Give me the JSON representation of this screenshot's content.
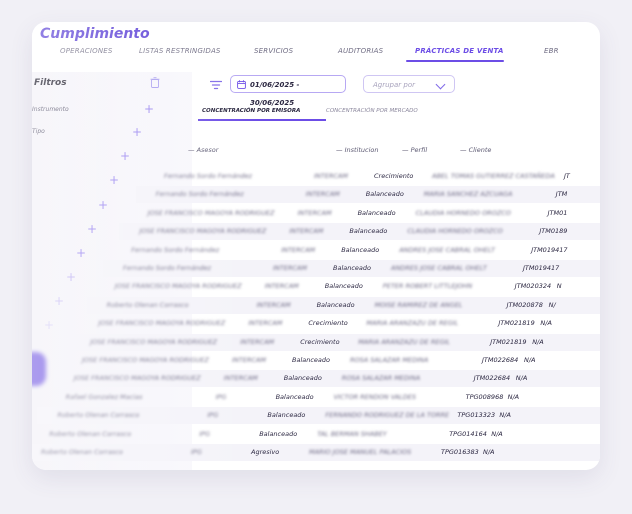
{
  "app": {
    "title": "Cumplimiento"
  },
  "tabs": [
    {
      "label": "OPERACIONES"
    },
    {
      "label": "LISTAS RESTRINGIDAS"
    },
    {
      "label": "SERVICIOS"
    },
    {
      "label": "AUDITORIAS"
    },
    {
      "label": "PRÁCTICAS DE VENTA"
    },
    {
      "label": "EBR"
    }
  ],
  "sidebar": {
    "title": "Filtros",
    "trash_icon": "trash-icon",
    "items": [
      {
        "label": "Instrumento"
      },
      {
        "label": "Tipo"
      }
    ],
    "plus_icon": "plus-icon"
  },
  "toolbar": {
    "filter_icon": "filter-lines-icon",
    "date_range": "01/06/2025 - 30/06/2025",
    "calendar_icon": "calendar-icon",
    "group_placeholder": "Agrupar por",
    "chevron_icon": "chevron-down-icon"
  },
  "subtabs": [
    {
      "label": "CONCENTRACIÓN POR EMISORA"
    },
    {
      "label": "CONCENTRACIÓN POR MERCADO"
    }
  ],
  "table": {
    "headers": [
      "Asesor",
      "Institucion",
      "Perfil",
      "Cliente"
    ],
    "rows": [
      {
        "asesor": "Fernando Sordo Fernández",
        "institucion": "INTERCAM",
        "perfil": "Crecimiento",
        "cliente": "ABEL TOMAS GUTIERREZ CASTAÑEDA",
        "codigo": "JT",
        "na": ""
      },
      {
        "asesor": "Fernando Sordo Fernández",
        "institucion": "INTERCAM",
        "perfil": "Balanceado",
        "cliente": "MARIA SANCHEZ AZCUAGA",
        "codigo": "JTM",
        "na": ""
      },
      {
        "asesor": "JOSE FRANCISCO MAGOYA RODRIGUEZ",
        "institucion": "INTERCAM",
        "perfil": "Balanceado",
        "cliente": "CLAUDIA HORNEDO OROZCO",
        "codigo": "JTM01",
        "na": ""
      },
      {
        "asesor": "JOSE FRANCISCO MAGOYA RODRIGUEZ",
        "institucion": "INTERCAM",
        "perfil": "Balanceado",
        "cliente": "CLAUDIA HORNEDO OROZCO",
        "codigo": "JTM0189",
        "na": ""
      },
      {
        "asesor": "Fernando Sordo Fernández",
        "institucion": "INTERCAM",
        "perfil": "Balanceado",
        "cliente": "ANDRES JOSE CABRAL OHELT",
        "codigo": "JTM019417",
        "na": ""
      },
      {
        "asesor": "Fernando Sordo Fernández",
        "institucion": "INTERCAM",
        "perfil": "Balanceado",
        "cliente": "ANDRES JOSE CABRAL OHELT",
        "codigo": "JTM019417",
        "na": ""
      },
      {
        "asesor": "JOSE FRANCISCO MAGOYA RODRIGUEZ",
        "institucion": "INTERCAM",
        "perfil": "Balanceado",
        "cliente": "PETER ROBERT LITTLEJOHN",
        "codigo": "JTM020324",
        "na": "N"
      },
      {
        "asesor": "Roberto Olenan Corrasco",
        "institucion": "INTERCAM",
        "perfil": "Balanceado",
        "cliente": "MOISE RAMIREZ DE ANGEL",
        "codigo": "JTM020878",
        "na": "N/"
      },
      {
        "asesor": "JOSE FRANCISCO MAGOYA RODRIGUEZ",
        "institucion": "INTERCAM",
        "perfil": "Crecimiento",
        "cliente": "MARIA ARANZAZU DE REGIL",
        "codigo": "JTM021819",
        "na": "N/A"
      },
      {
        "asesor": "JOSE FRANCISCO MAGOYA RODRIGUEZ",
        "institucion": "INTERCAM",
        "perfil": "Crecimiento",
        "cliente": "MARIA ARANZAZU DE REGIL",
        "codigo": "JTM021819",
        "na": "N/A"
      },
      {
        "asesor": "JOSE FRANCISCO MAGOYA RODRIGUEZ",
        "institucion": "INTERCAM",
        "perfil": "Balanceado",
        "cliente": "ROSA SALAZAR MEDINA",
        "codigo": "JTM022684",
        "na": "N/A"
      },
      {
        "asesor": "JOSE FRANCISCO MAGOYA RODRIGUEZ",
        "institucion": "INTERCAM",
        "perfil": "Balanceado",
        "cliente": "ROSA SALAZAR MEDINA",
        "codigo": "JTM022684",
        "na": "N/A"
      },
      {
        "asesor": "Rafael Gonzalez Macias",
        "institucion": "IPG",
        "perfil": "Balanceado",
        "cliente": "VICTOR RENDON VALDES",
        "codigo": "TPG008968",
        "na": "N/A"
      },
      {
        "asesor": "Roberto Olenan Corrasco",
        "institucion": "IPG",
        "perfil": "Balanceado",
        "cliente": "FERNANDO RODRIGUEZ DE LA TORRE",
        "codigo": "TPG013323",
        "na": "N/A"
      },
      {
        "asesor": "Roberto Olenan Corrasco",
        "institucion": "IPG",
        "perfil": "Balanceado",
        "cliente": "TAL BERMAN SHABEY",
        "codigo": "TPG014164",
        "na": "N/A"
      },
      {
        "asesor": "Roberto Olenan Corrasco",
        "institucion": "IPG",
        "perfil": "Agresivo",
        "cliente": "MARIO JOSE MANUEL PALACIOS",
        "codigo": "TPG016383",
        "na": "N/A"
      }
    ]
  },
  "colors": {
    "accent": "#6c4de6",
    "title": "#5a3fd6",
    "page_bg": "#f1f0f6"
  }
}
